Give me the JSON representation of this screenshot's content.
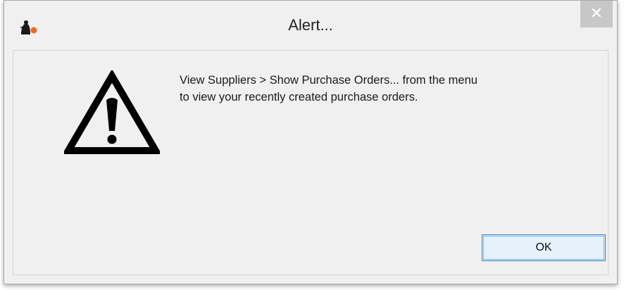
{
  "window": {
    "title": "Alert...",
    "close_label": "✕"
  },
  "message": {
    "line1": "View Suppliers > Show Purchase Orders... from the menu",
    "line2": "to view your recently created purchase orders."
  },
  "buttons": {
    "ok_label": "OK"
  },
  "icons": {
    "app": "app-icon",
    "warning": "warning-triangle-icon",
    "close": "close-icon"
  },
  "colors": {
    "window_bg": "#f0f0f0",
    "close_bg": "#c7c7c7",
    "ok_border": "#3c7fb1",
    "ok_bg": "#e5f1fb"
  }
}
